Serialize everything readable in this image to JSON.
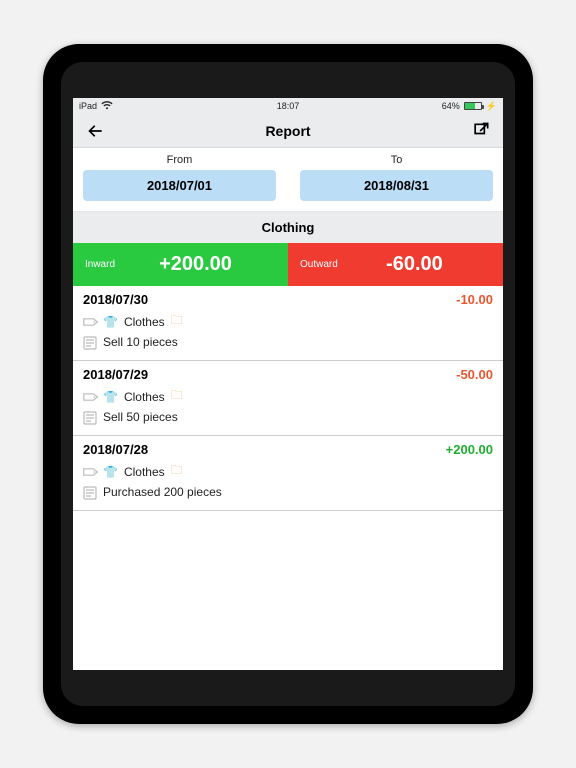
{
  "statusbar": {
    "carrier": "iPad",
    "time": "18:07",
    "battery_pct": "64%"
  },
  "nav": {
    "title": "Report"
  },
  "daterange": {
    "from_label": "From",
    "to_label": "To",
    "from_value": "2018/07/01",
    "to_value": "2018/08/31"
  },
  "category": "Clothing",
  "totals": {
    "inward_label": "Inward",
    "inward_value": "+200.00",
    "outward_label": "Outward",
    "outward_value": "-60.00"
  },
  "transactions": [
    {
      "date": "2018/07/30",
      "amount": "-10.00",
      "sign": "neg",
      "tag": "Clothes",
      "note": "Sell 10 pieces"
    },
    {
      "date": "2018/07/29",
      "amount": "-50.00",
      "sign": "neg",
      "tag": "Clothes",
      "note": "Sell 50 pieces"
    },
    {
      "date": "2018/07/28",
      "amount": "+200.00",
      "sign": "pos",
      "tag": "Clothes",
      "note": "Purchased 200 pieces"
    }
  ]
}
